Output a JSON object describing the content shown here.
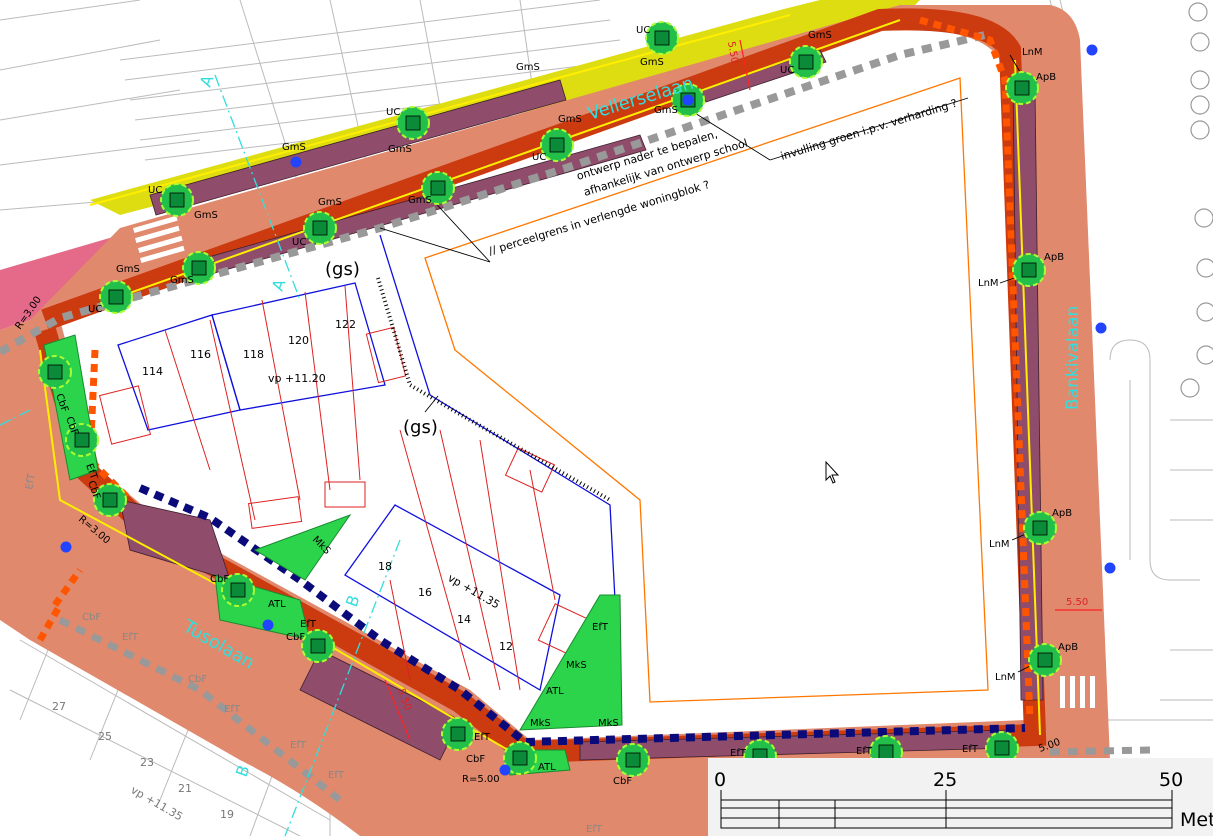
{
  "streets": {
    "vellerselaan": "Vellerselaan",
    "bankivalaan": "Bankivalaan",
    "tusolaan": "Tusolaan"
  },
  "annotations": {
    "gs_1": "(gs)",
    "gs_2": "(gs)",
    "ontwerp_line1": "ontwerp nader te bepalen,",
    "ontwerp_line2": "afhankelijk van ontwerp school",
    "perceelgrens": "// perceelgrens in verlengde woningblok ?",
    "invulling": "invulling groen i.p.v. verharding ?"
  },
  "lots": {
    "north_row": [
      "114",
      "116",
      "118",
      "120",
      "122"
    ],
    "north_vp": "vp +11.20",
    "center_row": [
      "18",
      "16",
      "14",
      "12"
    ],
    "center_vp": "vp +11.35",
    "west_row": [
      "27",
      "25",
      "23",
      "21",
      "19"
    ],
    "west_vp": "vp +11.35"
  },
  "section_marks": {
    "a": "A",
    "b": "B"
  },
  "dimensions": {
    "w550": "5.50",
    "r300a": "R=3.00",
    "r300b": "R=3.00",
    "r500": "R=5.00",
    "v500": "5.00",
    "v550": "5.50",
    "v550b": "5.50"
  },
  "trees": {
    "gms": "GmS",
    "uc": "UC",
    "lnm": "LnM",
    "apb": "ApB",
    "cbf": "CbF",
    "eft": "EfT",
    "mks": "MkS",
    "atl": "ATL"
  },
  "scale_bar": {
    "ticks": [
      "0",
      "25",
      "50"
    ],
    "unit": "Met"
  },
  "colors": {
    "road": "#e0896c",
    "sidewalk": "#cc3a10",
    "parking": "#8f4d6b",
    "green": "#2bd44b",
    "tree": "#22c04a",
    "yellow": "#dddd11",
    "orange_line": "#ff7700",
    "blue_line": "#1010dd",
    "cyan": "#33dddd"
  }
}
